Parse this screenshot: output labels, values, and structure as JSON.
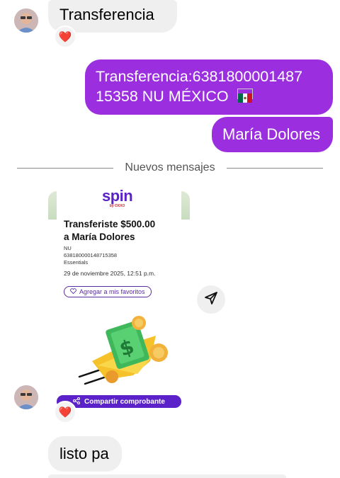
{
  "messages": {
    "incoming_1": "Transferencia",
    "outgoing_1_line1": "Transferencia:6381800001487",
    "outgoing_1_line2": "15358 NU MÉXICO",
    "outgoing_1_flag": "🇲🇽",
    "outgoing_2": "María Dolores",
    "incoming_last": "listo pa"
  },
  "divider": {
    "label": "Nuevos mensajes"
  },
  "reactions": {
    "heart": "❤️"
  },
  "receipt": {
    "brand": "spin",
    "brand_sub": "by OXXO",
    "title_line1": "Transferiste $500.00",
    "title_line2": "a María Dolores",
    "bank": "NU",
    "account": "638180000148715358",
    "account_type": "Essentials",
    "datetime": "29 de noviembre 2025, 12:51 p.m.",
    "fav_label": "Agregar a mis favoritos",
    "share_label": "Compartir comprobante"
  },
  "colors": {
    "outgoing_bubble": "#9b2fe0",
    "incoming_bubble": "#efefef",
    "spin_purple": "#5a22c8"
  }
}
